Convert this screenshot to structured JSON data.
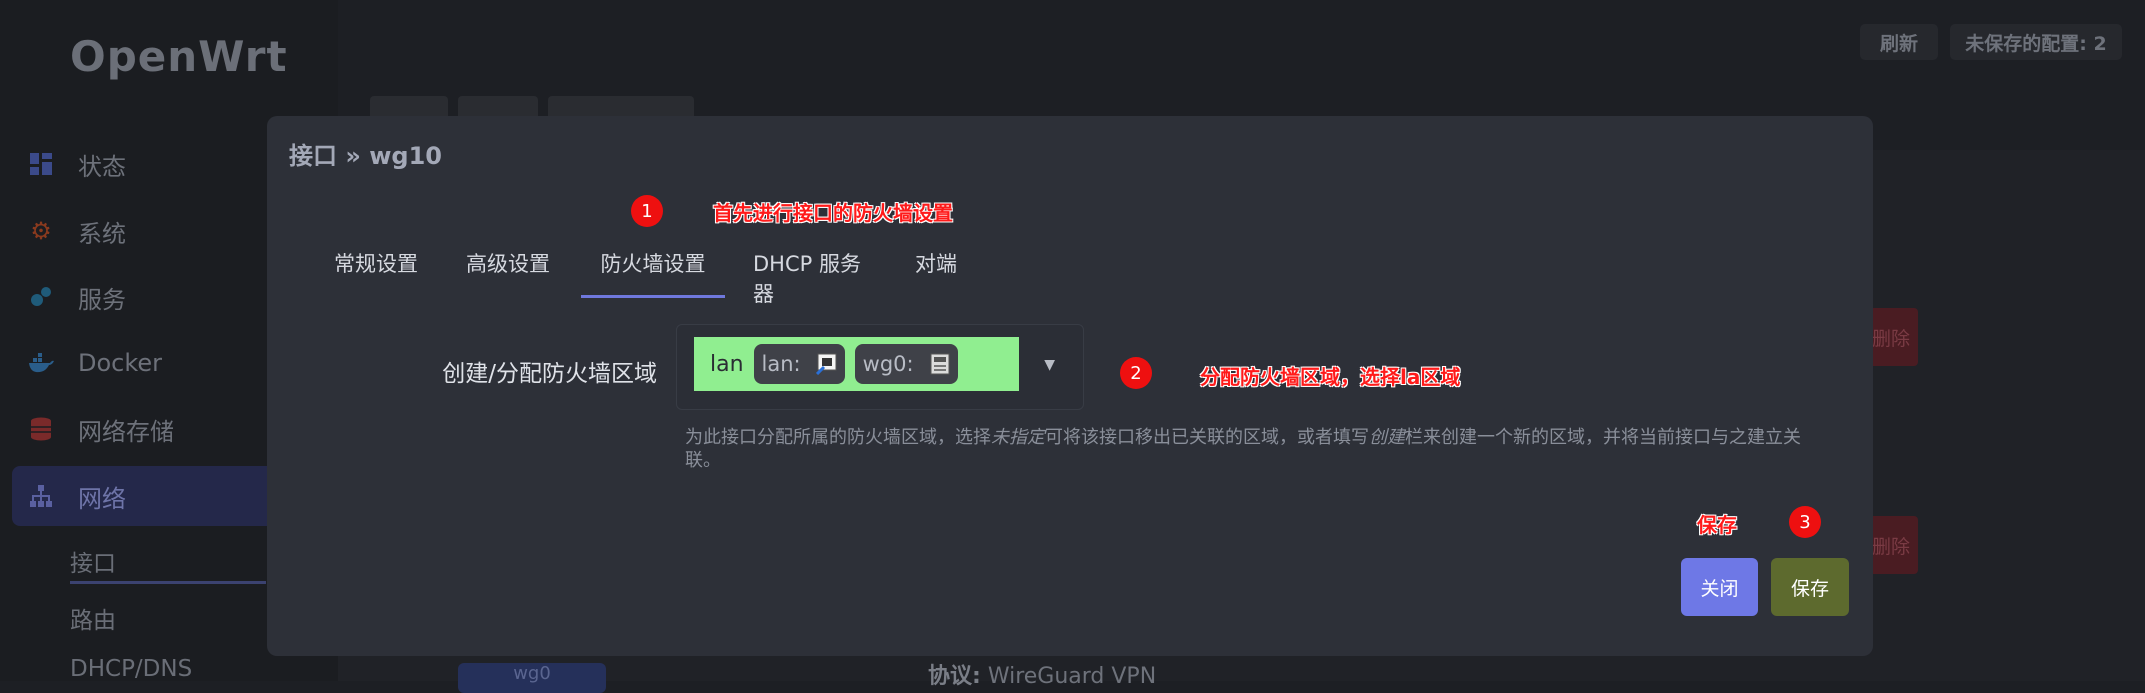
{
  "app": {
    "logo": "OpenWrt"
  },
  "topbar": {
    "refresh_label": "刷新",
    "unsaved_label": "未保存的配置: 2"
  },
  "sidebar": {
    "items": [
      {
        "label": "状态",
        "icon": "dashboard-icon"
      },
      {
        "label": "系统",
        "icon": "gear-icon"
      },
      {
        "label": "服务",
        "icon": "services-icon"
      },
      {
        "label": "Docker",
        "icon": "docker-icon"
      },
      {
        "label": "网络存储",
        "icon": "storage-icon"
      },
      {
        "label": "网络",
        "icon": "network-icon",
        "active": true
      }
    ],
    "subitems": [
      {
        "label": "接口",
        "active": true
      },
      {
        "label": "路由"
      },
      {
        "label": "DHCP/DNS"
      }
    ]
  },
  "background": {
    "delete_label": "删除",
    "protocol_label": "协议:",
    "protocol_value": "WireGuard VPN",
    "badge_label": "wg0"
  },
  "modal": {
    "title": "接口 » wg10",
    "tabs": [
      {
        "label": "常规设置"
      },
      {
        "label": "高级设置"
      },
      {
        "label": "防火墙设置",
        "active": true
      },
      {
        "label": "DHCP 服务器"
      },
      {
        "label": "对端"
      }
    ],
    "field_label": "创建/分配防火墙区域",
    "zone": {
      "name": "lan",
      "chips": [
        {
          "label": "lan:"
        },
        {
          "label": "wg0:"
        }
      ],
      "color": "#90ee90"
    },
    "help": {
      "part1": "为此接口分配所属的防火墙区域，选择",
      "em1": "未指定",
      "part2": "可将该接口移出已关联的区域，或者填写",
      "em2": "创建",
      "part3": "栏来创建一个新的区域，并将当前接口与之建立关联。"
    },
    "close_label": "关闭",
    "save_label": "保存"
  },
  "annotations": {
    "step1_number": "1",
    "step1_text": "首先进行接口的防火墙设置",
    "step2_number": "2",
    "step2_text": "分配防火墙区域，选择la区域",
    "step3_number": "3",
    "step3_text": "保存"
  }
}
